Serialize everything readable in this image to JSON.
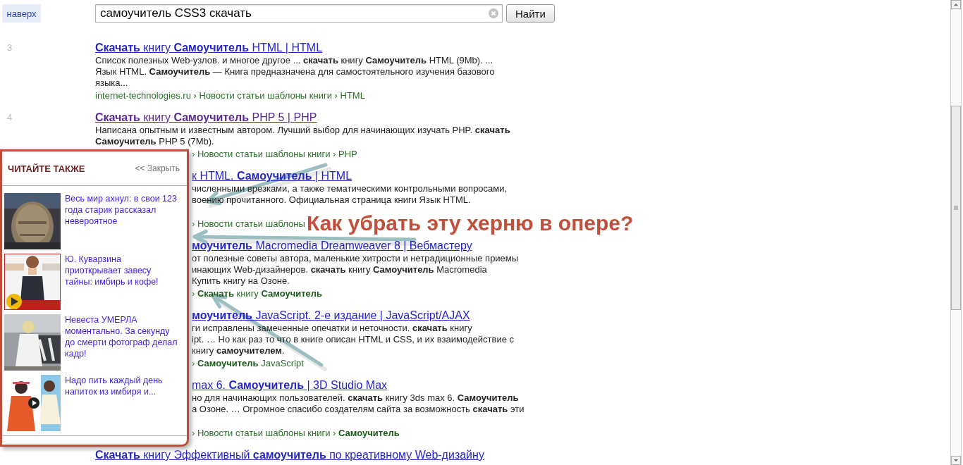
{
  "top_button": "наверх",
  "search": {
    "value": "самоучитель CSS3 скачать",
    "button": "Найти"
  },
  "results": [
    {
      "number": "3",
      "kind": "plain",
      "visited": false,
      "title": "**Скачать** книгу **Самоучитель** HTML | HTML",
      "snippet": "Список полезных Web-узлов. и многое другое ... **скачать** книгу **Самоучитель** HTML (9Mb). ...\nЯзык HTML. **Самоучитель** — Книга предназначена для самостоятельного изучения базового\nязыка...",
      "line_hidden": false,
      "url": "internet-technologies.ru › Новости статьи шаблоны книги › HTML"
    },
    {
      "number": "4",
      "kind": "url_covered",
      "visited": true,
      "title": "**Скачать** книгу **Самоучитель** PHP 5 | PHP",
      "snippet": "Написана опытным и известным автором. Лучший выбор для начинающих изучать PHP. **скачать**\n**Самоучитель** PHP 5 (7Mb).",
      "line_hidden": false,
      "url": "› Новости статьи шаблоны книги › PHP"
    },
    {
      "kind": "covered",
      "visited": false,
      "title": "к HTML. **Самоучитель** | HTML",
      "snippet": "численными врезками, а также тематическими контрольными вопросами,\nвоению прочитанного. Официальная страница книги Язык HTML.",
      "line_hidden": true,
      "url": "› Новости статьи шаблоны"
    },
    {
      "kind": "covered",
      "visited": false,
      "title": "**моучитель** Macromedia Dreamweaver 8 | Вебмастеру",
      "snippet": "от полезные советы автора, маленькие хитрости и нетрадиционные приемы\nинающих Web-дизайнеров. **скачать** книгу **Самоучитель** Macromedia\nКупить книгу на Озоне.",
      "line_hidden": false,
      "url": "› **Скачать** книгу **Самоучитель**"
    },
    {
      "kind": "covered",
      "visited": false,
      "title": "**моучитель** JavaScript. 2-е издание | JavaScript/AJAX",
      "snippet": "ги исправлены замеченные опечатки и неточности. **скачать** книгу\nipt. … Но как раз то что в книге описан HTML и CSS, и их взаимодействие с\nкнигу **самоучителем**.",
      "line_hidden": false,
      "url": "› **Самоучитель** JavaScript"
    },
    {
      "kind": "covered",
      "visited": false,
      "title": "max 6. **Самоучитель** | 3D Studio Max",
      "snippet": "но для начинающих пользователей. **скачать** книгу 3ds max 6. **Самоучитель**\nа Озоне. … Огромное спасибо создателям сайта за возможность **скачать** эти",
      "line_hidden": true,
      "url": "› Новости статьи шаблоны книги › **Самоучитель**"
    },
    {
      "kind": "plain",
      "visited": false,
      "title": "**Скачать** книгу Эффективный **самоучитель** по креативному Web-дизайну"
    }
  ],
  "panel": {
    "title": "ЧИТАЙТЕ ТАКЖЕ",
    "close": "<< Закрыть",
    "items": [
      {
        "kind": "picture",
        "text": "Весь мир ахнул: в свои 123 года старик рассказал невероятное"
      },
      {
        "kind": "picture",
        "text": "Ю. Куварзина приоткрывает завесу тайны: имбирь и кофе!"
      },
      {
        "kind": "picture",
        "text": "Невеста УМЕРЛА моментально. За секунду до смерти фотограф делал кадр!"
      },
      {
        "kind": "picture",
        "text": "Надо пить каждый день напиток из имбиря и..."
      }
    ]
  },
  "annotation": "Как убрать эту херню в опере?"
}
